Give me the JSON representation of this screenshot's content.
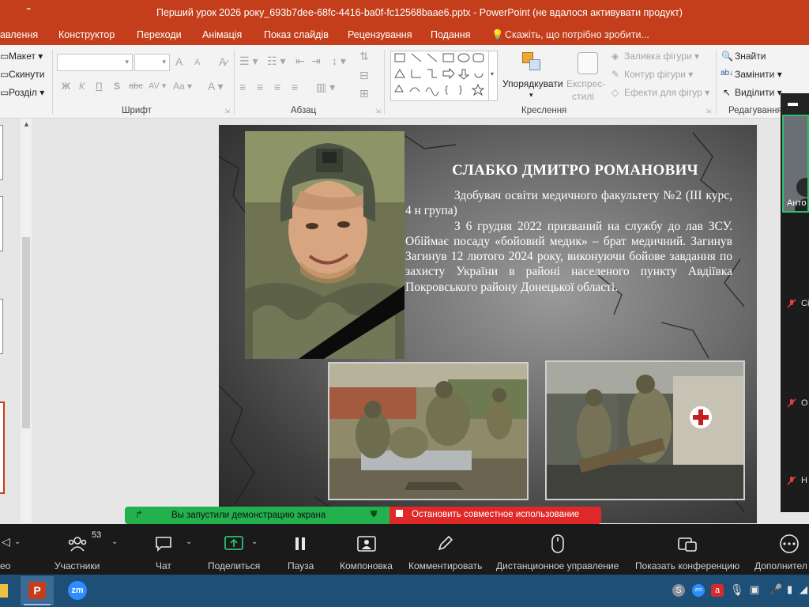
{
  "titlebar": {
    "quick_access": "⁼",
    "title": "Перший урок 2026 року_693b7dee-68fc-4416-ba0f-fc12568baae6.pptx  -  PowerPoint (не вдалося активувати продукт)"
  },
  "ribbon_tabs": [
    "авлення",
    "Конструктор",
    "Переходи",
    "Анімація",
    "Показ слайдів",
    "Рецензування",
    "Подання"
  ],
  "tell_me": "Скажіть, що потрібно зробити...",
  "ribbon": {
    "slides": {
      "layout": "Макет",
      "reset": "Скинути",
      "section": "Розділ"
    },
    "font": {
      "label": "Шрифт",
      "bold": "Ж",
      "italic": "К",
      "underline": "П",
      "shadow": "S",
      "strike": "abc",
      "spacing": "AV",
      "case": "Aa",
      "grow": "A",
      "shrink": "A",
      "color": "A"
    },
    "paragraph": {
      "label": "Абзац"
    },
    "drawing": {
      "label": "Креслення",
      "arrange": "Упорядкувати",
      "quick_styles_1": "Експрес-",
      "quick_styles_2": "стилі",
      "fill": "Заливка фігури",
      "outline": "Контур фігури",
      "effects": "Ефекти для фігур"
    },
    "editing": {
      "label": "Редагування",
      "find": "Знайти",
      "replace": "Замінити",
      "select": "Виділити"
    }
  },
  "slide": {
    "name": "СЛАБКО ДМИТРО РОМАНОВИЧ",
    "para1": "Здобувач освіти медичного факультету №2 (ІІІ курс, 4 н група)",
    "para2": "З 6 грудня 2022 призваний на службу до лав ЗСУ. Обіймає  посаду «бойовий медик» – брат медичний. Загинув Загинув 12 лютого 2024 року, виконуючи бойове завдання по захисту України в районі населеного пункту Авдіївка Покровського району Донецької області."
  },
  "zoom_panel": {
    "participant_video_name": "Анто",
    "participants": [
      {
        "name": "Сі"
      },
      {
        "name": "О"
      },
      {
        "name": "Н"
      }
    ]
  },
  "share_bar": {
    "status": "Вы запустили демонстрацию экрана",
    "stop": "Остановить совместное использование"
  },
  "zoom_toolbar": {
    "video_label": "ео",
    "participants_label": "Участники",
    "participants_count": "53",
    "chat_label": "Чат",
    "share_label": "Поделиться",
    "pause_label": "Пауза",
    "layout_label": "Компоновка",
    "annotate_label": "Комментировать",
    "remote_label": "Дистанционное управление",
    "show_label": "Показать конференцию",
    "more_label": "Дополнител"
  },
  "taskbar": {
    "zoom_label": "zm"
  },
  "colors": {
    "powerpoint_accent": "#c43e1c",
    "share_green": "#22b14c",
    "share_red": "#e02828",
    "zoom_bar": "#1a1a1a",
    "taskbar": "#1e4f77"
  }
}
